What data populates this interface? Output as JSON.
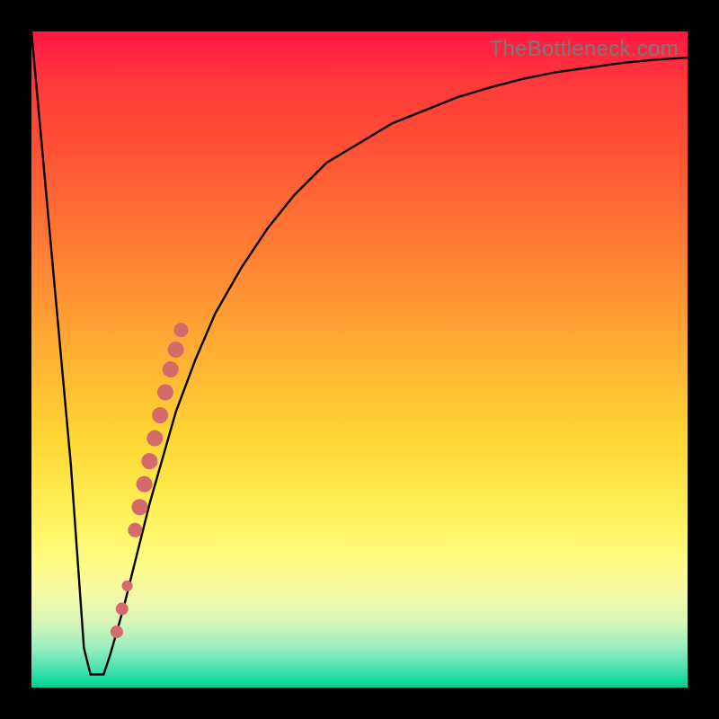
{
  "watermark": "TheBottleneck.com",
  "chart_data": {
    "type": "line",
    "title": "",
    "xlabel": "",
    "ylabel": "",
    "xlim": [
      0,
      100
    ],
    "ylim": [
      0,
      100
    ],
    "background_gradient": {
      "top_color": "#ff1744",
      "mid_color": "#ffe14d",
      "bottom_color": "#13d8a0",
      "meaning": "red=high bottleneck, green=low bottleneck"
    },
    "series": [
      {
        "name": "bottleneck-curve",
        "color": "#000000",
        "x": [
          0,
          2,
          4,
          6,
          7,
          8,
          9,
          10,
          11,
          12,
          14,
          16,
          18,
          20,
          22,
          25,
          28,
          32,
          36,
          40,
          45,
          50,
          55,
          60,
          65,
          70,
          75,
          80,
          85,
          90,
          95,
          100
        ],
        "y": [
          100,
          78,
          56,
          34,
          20,
          6,
          2,
          2,
          2,
          5,
          12,
          20,
          28,
          35,
          42,
          50,
          57,
          64,
          70,
          75,
          80,
          83,
          86,
          88,
          90,
          91.5,
          92.8,
          93.8,
          94.5,
          95.2,
          95.7,
          96
        ]
      },
      {
        "name": "highlighted-range-dots",
        "color": "#d46a6a",
        "style": "markers",
        "x": [
          13.0,
          13.8,
          14.6,
          15.8,
          16.5,
          17.2,
          18.0,
          18.8,
          19.6,
          20.4,
          21.2,
          22.0,
          22.8
        ],
        "y": [
          8.5,
          12.0,
          15.5,
          24.0,
          27.5,
          31.0,
          34.5,
          38.0,
          41.5,
          45.0,
          48.5,
          51.5,
          54.5
        ]
      }
    ],
    "optimal_x": 9,
    "optimal_y": 2
  },
  "chart_frame": {
    "border_color": "#000000",
    "border_width_px": 35
  }
}
